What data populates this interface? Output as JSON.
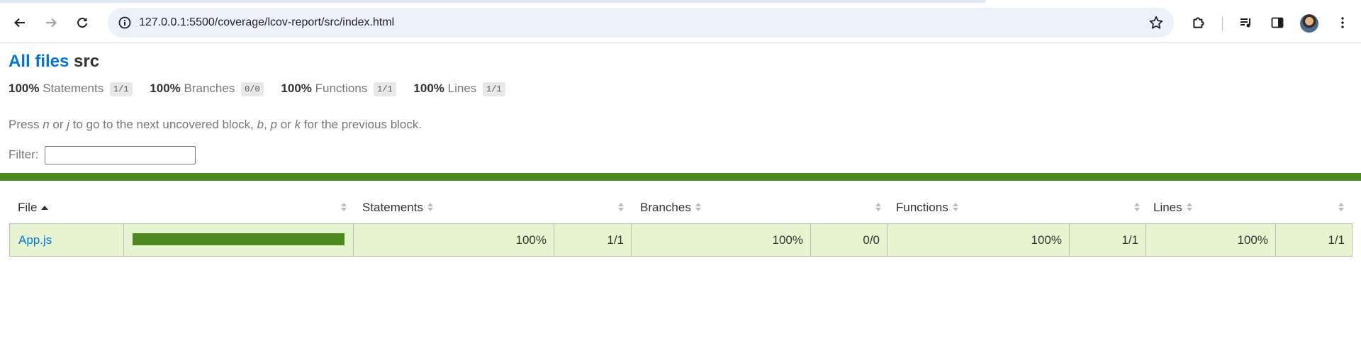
{
  "browser": {
    "url": "127.0.0.1:5500/coverage/lcov-report/src/index.html",
    "icons": [
      "back-arrow-icon",
      "forward-arrow-icon",
      "reload-icon",
      "site-info-icon",
      "bookmark-star-icon",
      "extensions-icon",
      "media-queue-icon",
      "side-panel-icon",
      "profile-avatar",
      "more-menu-icon"
    ]
  },
  "header": {
    "all_files": "All files",
    "dir": "src"
  },
  "summary": [
    {
      "pct": "100%",
      "label": "Statements",
      "frac": "1/1"
    },
    {
      "pct": "100%",
      "label": "Branches",
      "frac": "0/0"
    },
    {
      "pct": "100%",
      "label": "Functions",
      "frac": "1/1"
    },
    {
      "pct": "100%",
      "label": "Lines",
      "frac": "1/1"
    }
  ],
  "hint": {
    "t1": "Press ",
    "k1": "n",
    "t2": " or ",
    "k2": "j",
    "t3": " to go to the next uncovered block, ",
    "k3": "b",
    "t4": ", ",
    "k4": "p",
    "t5": " or ",
    "k5": "k",
    "t6": " for the previous block."
  },
  "filter": {
    "label": "Filter:",
    "value": ""
  },
  "colors": {
    "high": "#4d8a1e",
    "row_bg": "#e6f5d0",
    "link": "#0074d9"
  },
  "table": {
    "headers": {
      "file": "File",
      "statements": "Statements",
      "branches": "Branches",
      "functions": "Functions",
      "lines": "Lines"
    },
    "rows": [
      {
        "file": "App.js",
        "coverage": 1.0,
        "stmt_pct": "100%",
        "stmt_frac": "1/1",
        "br_pct": "100%",
        "br_frac": "0/0",
        "fn_pct": "100%",
        "fn_frac": "1/1",
        "ln_pct": "100%",
        "ln_frac": "1/1"
      }
    ]
  }
}
